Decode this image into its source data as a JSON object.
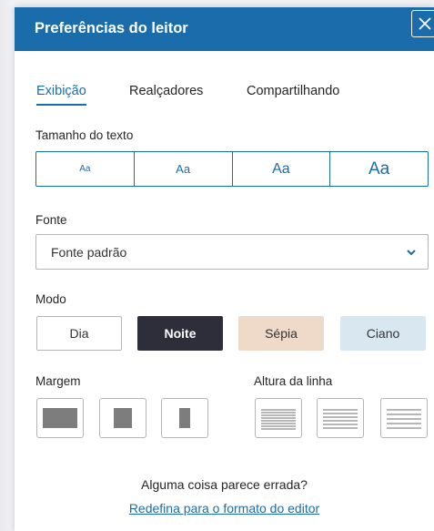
{
  "header": {
    "title": "Preferências do leitor"
  },
  "tabs": [
    {
      "label": "Exibição",
      "active": true
    },
    {
      "label": "Realçadores",
      "active": false
    },
    {
      "label": "Compartilhando",
      "active": false
    }
  ],
  "text_size": {
    "label": "Tamanho do texto",
    "options": [
      "Aa",
      "Aa",
      "Aa",
      "Aa"
    ]
  },
  "font": {
    "label": "Fonte",
    "value": "Fonte padrão"
  },
  "mode": {
    "label": "Modo",
    "options": [
      {
        "label": "Dia",
        "selected": false
      },
      {
        "label": "Noite",
        "selected": true
      },
      {
        "label": "Sépia",
        "selected": false
      },
      {
        "label": "Ciano",
        "selected": false
      }
    ]
  },
  "margin": {
    "label": "Margem"
  },
  "line_height": {
    "label": "Altura da linha"
  },
  "footer": {
    "text": "Alguma coisa parece errada?",
    "link": "Redefina para o formato do editor"
  },
  "colors": {
    "accent": "#1b6cab",
    "night": "#2e2e3a",
    "sepia": "#efd9c9",
    "cyan": "#d9e8f0"
  },
  "icons": [
    "close-icon",
    "chevron-down-icon",
    "margin-wide-icon",
    "margin-medium-icon",
    "margin-narrow-icon",
    "line-height-compact-icon",
    "line-height-normal-icon",
    "line-height-loose-icon"
  ]
}
